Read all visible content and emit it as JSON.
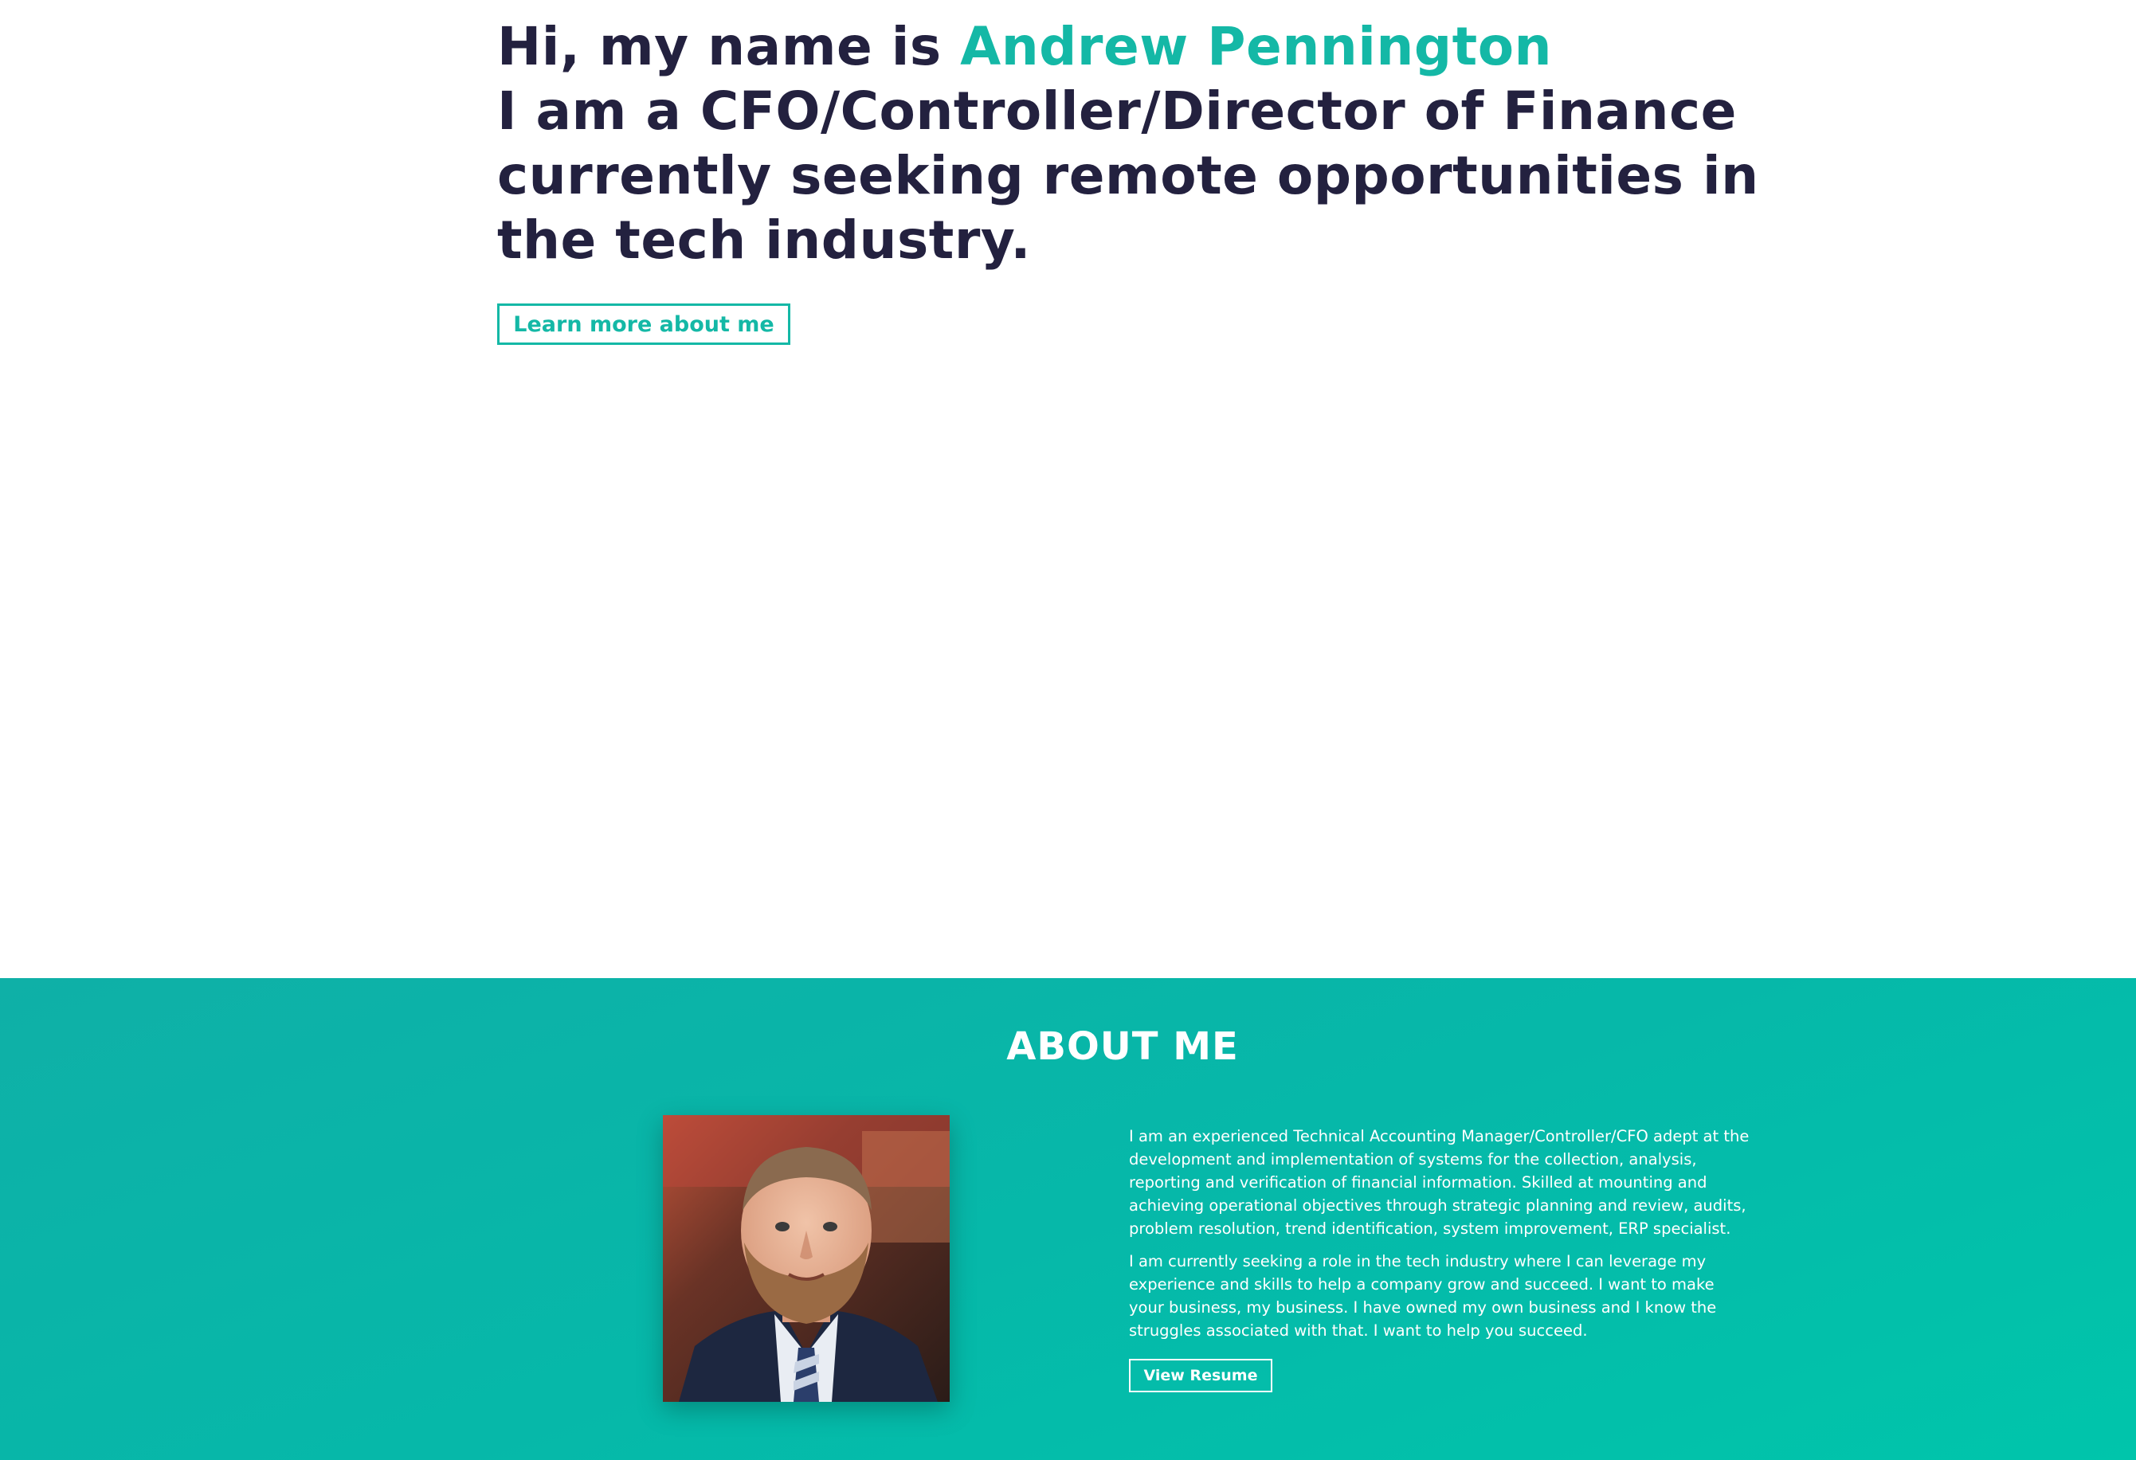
{
  "hero": {
    "greeting": "Hi, my name is ",
    "name": "Andrew Pennington",
    "tagline_lines": [
      "I am a CFO/Controller/Director of Finance",
      "currently seeking remote opportunities in",
      "the tech industry."
    ],
    "cta_label": "Learn more about me"
  },
  "about": {
    "title": "ABOUT ME",
    "photo_alt": "Portrait of Andrew Pennington",
    "paragraphs": [
      "I am an experienced Technical Accounting Manager/Controller/CFO adept at the development and implementation of systems for the collection, analysis, reporting and verification of financial information. Skilled at mounting and achieving operational objectives through strategic planning and review, audits, problem resolution, trend identification, system improvement, ERP specialist.",
      "I am currently seeking a role in the tech industry where I can leverage my experience and skills to help a company grow and succeed. I want to make your business, my business. I have owned my own business and I know the struggles associated with that. I want to help you succeed."
    ],
    "resume_label": "View Resume"
  },
  "colors": {
    "heading": "#23213f",
    "accent": "#14b8a6",
    "about_bg_start": "#0fb0a7",
    "about_bg_end": "#00c5ab",
    "white": "#ffffff"
  }
}
